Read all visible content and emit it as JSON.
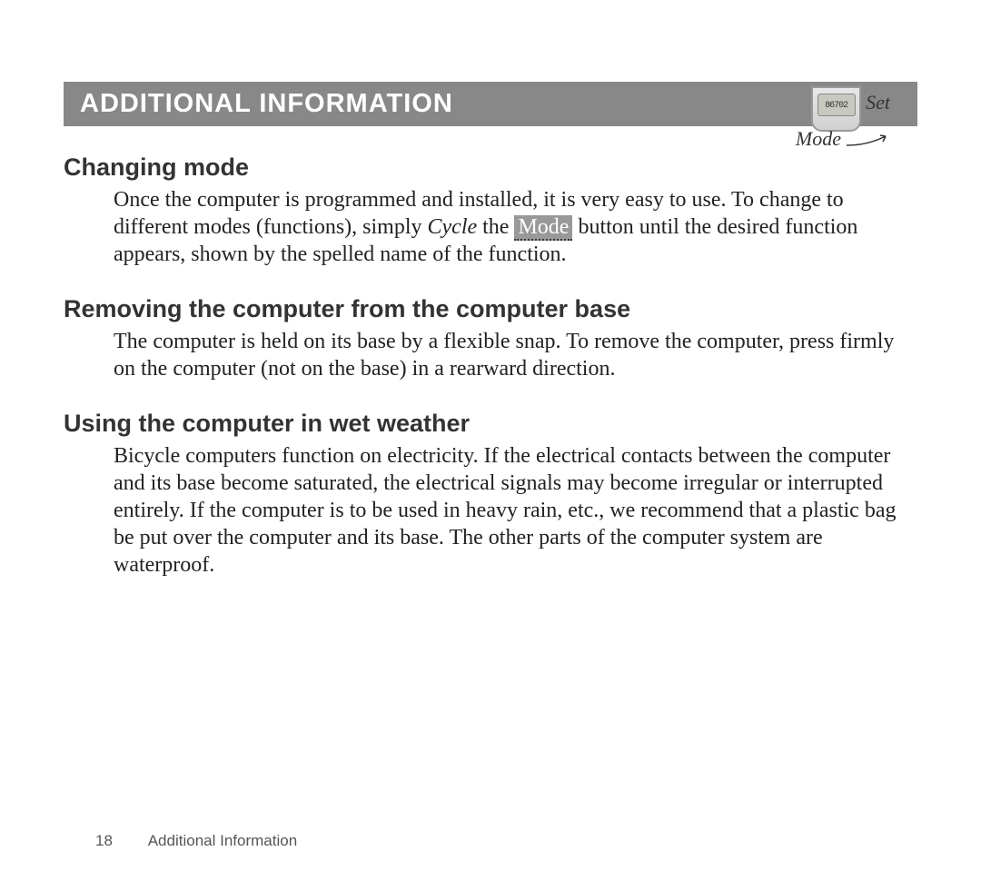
{
  "device": {
    "display": "86702",
    "set_label": "Set",
    "mode_label": "Mode"
  },
  "header": "ADDITIONAL INFORMATION",
  "sections": [
    {
      "title": "Changing mode",
      "body_parts": {
        "p1": "Once the computer is programmed and installed, it is very easy to use. To change to different modes (functions), simply ",
        "cycle": "Cycle",
        "p2": " the ",
        "mode_hl": "Mode",
        "p3": " button until the desired function appears, shown by the spelled name of the function."
      }
    },
    {
      "title": "Removing the computer from the computer base",
      "body": "The computer is held on its base by a flexible snap. To remove the computer, press firmly on the computer (not on the base) in a rearward direction."
    },
    {
      "title": "Using the computer in wet weather",
      "body": "Bicycle computers function on electricity. If the electrical contacts between the computer and its base become saturated, the electrical signals may become irregular or interrupted entirely. If the computer is to be used in heavy rain, etc., we recommend that a plastic bag be put over the computer and its base. The other parts of the computer system are waterproof."
    }
  ],
  "footer": {
    "page": "18",
    "label": "Additional Information"
  }
}
